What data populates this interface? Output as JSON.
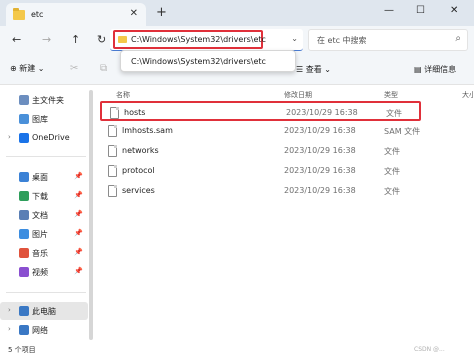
{
  "window": {
    "tab_title": "etc",
    "close_tab_glyph": "✕",
    "new_tab_glyph": "+",
    "minimize_glyph": "—",
    "maximize_glyph": "☐",
    "close_glyph": "✕"
  },
  "nav": {
    "back_glyph": "←",
    "forward_glyph": "→",
    "up_glyph": "↑",
    "refresh_glyph": "↻",
    "address_value": "C:\\Windows\\System32\\drivers\\etc",
    "address_chevron": "⌄",
    "search_placeholder": "在 etc 中搜索",
    "search_glyph": "⌕",
    "suggestion": "C:\\Windows\\System32\\drivers\\etc"
  },
  "toolbar": {
    "new_label": "⊕ 新建 ⌄",
    "cut_glyph": "✂",
    "copy_glyph": "⧉",
    "view_label": "☰ 查看 ⌄",
    "details_label": "▤ 详细信息"
  },
  "sidebar": {
    "items": [
      {
        "label": "主文件夹",
        "chevron": "",
        "icon": "home-icon",
        "color": "#6c8ebf",
        "pinned": false
      },
      {
        "label": "图库",
        "chevron": "",
        "icon": "gallery-icon",
        "color": "#4a90d9",
        "pinned": false
      },
      {
        "label": "OneDrive",
        "chevron": "›",
        "icon": "onedrive-icon",
        "color": "#1a73e8",
        "pinned": false
      },
      {
        "label": "桌面",
        "chevron": "",
        "icon": "desktop-icon",
        "color": "#3b82d6",
        "pinned": true
      },
      {
        "label": "下载",
        "chevron": "",
        "icon": "download-icon",
        "color": "#2e9e5b",
        "pinned": true
      },
      {
        "label": "文档",
        "chevron": "",
        "icon": "documents-icon",
        "color": "#5a7fb5",
        "pinned": true
      },
      {
        "label": "图片",
        "chevron": "",
        "icon": "pictures-icon",
        "color": "#3c8de0",
        "pinned": true
      },
      {
        "label": "音乐",
        "chevron": "",
        "icon": "music-icon",
        "color": "#e0533c",
        "pinned": true
      },
      {
        "label": "视频",
        "chevron": "",
        "icon": "videos-icon",
        "color": "#8a4fd0",
        "pinned": true
      },
      {
        "label": "此电脑",
        "chevron": "›",
        "icon": "this-pc-icon",
        "color": "#3a78c4",
        "pinned": false
      },
      {
        "label": "网络",
        "chevron": "›",
        "icon": "network-icon",
        "color": "#3a78c4",
        "pinned": false
      }
    ],
    "pin_glyph": "📌"
  },
  "list": {
    "columns": [
      "名称",
      "修改日期",
      "类型",
      "大小"
    ],
    "rows": [
      {
        "name": "hosts",
        "date": "2023/10/29 16:38",
        "type": "文件"
      },
      {
        "name": "lmhosts.sam",
        "date": "2023/10/29 16:38",
        "type": "SAM 文件"
      },
      {
        "name": "networks",
        "date": "2023/10/29 16:38",
        "type": "文件"
      },
      {
        "name": "protocol",
        "date": "2023/10/29 16:38",
        "type": "文件"
      },
      {
        "name": "services",
        "date": "2023/10/29 16:38",
        "type": "文件"
      }
    ]
  },
  "status": {
    "count": "5 个项目",
    "watermark": "CSDN @..."
  },
  "colors": {
    "highlight_border": "#e0303a",
    "accent": "#4a7bd0"
  }
}
